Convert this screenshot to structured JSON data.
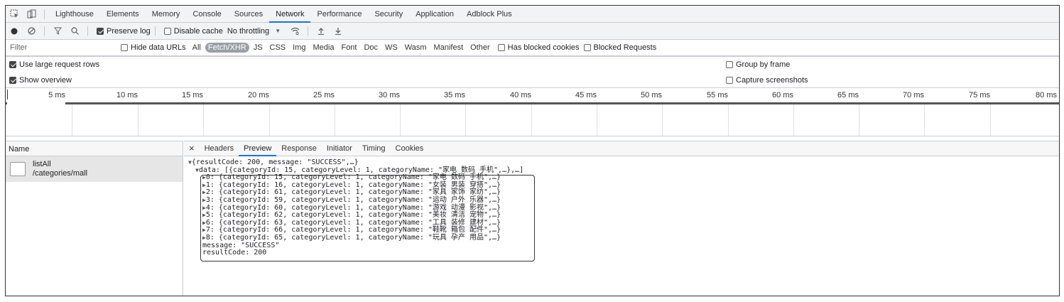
{
  "tabs": [
    "Lighthouse",
    "Elements",
    "Memory",
    "Console",
    "Sources",
    "Network",
    "Performance",
    "Security",
    "Application",
    "Adblock Plus"
  ],
  "active_tab": "Network",
  "toolbar": {
    "preserve_log": "Preserve log",
    "disable_cache": "Disable cache",
    "throttling": "No throttling"
  },
  "filter": {
    "placeholder": "Filter",
    "hide_data_urls": "Hide data URLs",
    "types": [
      "All",
      "Fetch/XHR",
      "JS",
      "CSS",
      "Img",
      "Media",
      "Font",
      "Doc",
      "WS",
      "Wasm",
      "Manifest",
      "Other"
    ],
    "active_type": "Fetch/XHR",
    "has_blocked_cookies": "Has blocked cookies",
    "blocked_requests": "Blocked Requests"
  },
  "options": {
    "large_rows": "Use large request rows",
    "show_overview": "Show overview",
    "group_by_frame": "Group by frame",
    "capture_screenshots": "Capture screenshots"
  },
  "timeline_ticks": [
    "5 ms",
    "10 ms",
    "15 ms",
    "20 ms",
    "25 ms",
    "30 ms",
    "35 ms",
    "40 ms",
    "45 ms",
    "50 ms",
    "55 ms",
    "60 ms",
    "65 ms",
    "70 ms",
    "75 ms",
    "80 ms"
  ],
  "requests": {
    "header": "Name",
    "items": [
      {
        "name": "listAll",
        "path": "/categories/mall"
      }
    ]
  },
  "detail_tabs": [
    "×",
    "Headers",
    "Preview",
    "Response",
    "Initiator",
    "Timing",
    "Cookies"
  ],
  "active_detail_tab": "Preview",
  "preview": {
    "root": "{resultCode: 200, message: \"SUCCESS\",…}",
    "data_line": "data: [{categoryId: 15, categoryLevel: 1, categoryName: \"家电 数码 手机\",…},…]",
    "items": [
      "0: {categoryId: 15, categoryLevel: 1, categoryName: \"家电 数码 手机\",…}",
      "1: {categoryId: 16, categoryLevel: 1, categoryName: \"女装 男装 穿搭\",…}",
      "2: {categoryId: 61, categoryLevel: 1, categoryName: \"家具 家饰 家纺\",…}",
      "3: {categoryId: 59, categoryLevel: 1, categoryName: \"运动 户外 乐器\",…}",
      "4: {categoryId: 60, categoryLevel: 1, categoryName: \"游戏 动漫 影视\",…}",
      "5: {categoryId: 62, categoryLevel: 1, categoryName: \"美妆 清洁 宠物\",…}",
      "6: {categoryId: 63, categoryLevel: 1, categoryName: \"工具 装修 建材\",…}",
      "7: {categoryId: 66, categoryLevel: 1, categoryName: \"鞋靴 箱包 配件\",…}",
      "8: {categoryId: 65, categoryLevel: 1, categoryName: \"玩具 孕产 用品\",…}"
    ],
    "message": "message: \"SUCCESS\"",
    "result_code": "resultCode: 200"
  }
}
